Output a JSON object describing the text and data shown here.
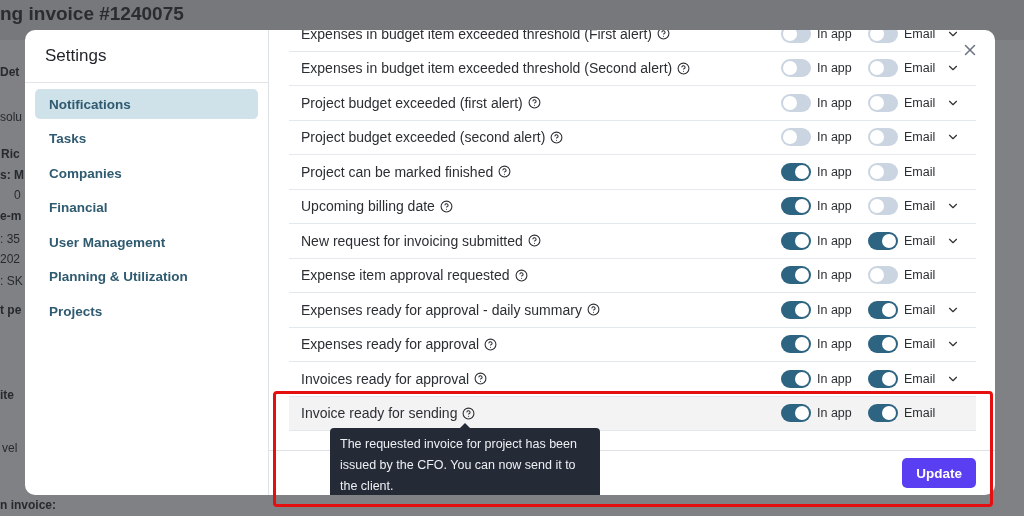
{
  "background": {
    "title": "ng invoice #1240075",
    "fragments": [
      {
        "text": "Det",
        "bold": true
      },
      {
        "text": "solu",
        "bold": false
      },
      {
        "text": "Ric",
        "bold": true
      },
      {
        "text": "s: M",
        "bold": true
      },
      {
        "text": "0",
        "bold": false
      },
      {
        "text": "e-m",
        "bold": true
      },
      {
        "text": ": 35",
        "bold": false
      },
      {
        "text": "202",
        "bold": false
      },
      {
        "text": ": SK",
        "bold": false
      },
      {
        "text": "t pe",
        "bold": true
      },
      {
        "text": "ite",
        "bold": true
      },
      {
        "text": "vel",
        "bold": false
      },
      {
        "text": "n invoice:",
        "bold": true
      }
    ]
  },
  "settings": {
    "title": "Settings",
    "sidebar": {
      "items": [
        {
          "label": "Notifications",
          "selected": true
        },
        {
          "label": "Tasks",
          "selected": false
        },
        {
          "label": "Companies",
          "selected": false
        },
        {
          "label": "Financial",
          "selected": false
        },
        {
          "label": "User Management",
          "selected": false
        },
        {
          "label": "Planning & Utilization",
          "selected": false
        },
        {
          "label": "Projects",
          "selected": false
        }
      ]
    },
    "notifications": [
      {
        "label": "Expenses in budget item exceeded threshold (First alert)",
        "in_app": false,
        "in_app_label": "In app",
        "email": false,
        "email_label": "Email",
        "expandable": true,
        "highlighted": false
      },
      {
        "label": "Expenses in budget item exceeded threshold (Second alert)",
        "in_app": false,
        "in_app_label": "In app",
        "email": false,
        "email_label": "Email",
        "expandable": true,
        "highlighted": false
      },
      {
        "label": "Project budget exceeded (first alert)",
        "in_app": false,
        "in_app_label": "In app",
        "email": false,
        "email_label": "Email",
        "expandable": true,
        "highlighted": false
      },
      {
        "label": "Project budget exceeded (second alert)",
        "in_app": false,
        "in_app_label": "In app",
        "email": false,
        "email_label": "Email",
        "expandable": true,
        "highlighted": false
      },
      {
        "label": "Project can be marked finished",
        "in_app": true,
        "in_app_label": "In app",
        "email": false,
        "email_label": "Email",
        "expandable": false,
        "highlighted": false
      },
      {
        "label": "Upcoming billing date",
        "in_app": true,
        "in_app_label": "In app",
        "email": false,
        "email_label": "Email",
        "expandable": true,
        "highlighted": false
      },
      {
        "label": "New request for invoicing submitted",
        "in_app": true,
        "in_app_label": "In app",
        "email": true,
        "email_label": "Email",
        "expandable": true,
        "highlighted": false
      },
      {
        "label": "Expense item approval requested",
        "in_app": true,
        "in_app_label": "In app",
        "email": false,
        "email_label": "Email",
        "expandable": false,
        "highlighted": false
      },
      {
        "label": "Expenses ready for approval - daily summary",
        "in_app": true,
        "in_app_label": "In app",
        "email": true,
        "email_label": "Email",
        "expandable": true,
        "highlighted": false
      },
      {
        "label": "Expenses ready for approval",
        "in_app": true,
        "in_app_label": "In app",
        "email": true,
        "email_label": "Email",
        "expandable": true,
        "highlighted": false
      },
      {
        "label": "Invoices ready for approval",
        "in_app": true,
        "in_app_label": "In app",
        "email": true,
        "email_label": "Email",
        "expandable": true,
        "highlighted": false
      },
      {
        "label": "Invoice ready for sending",
        "in_app": true,
        "in_app_label": "In app",
        "email": true,
        "email_label": "Email",
        "expandable": false,
        "highlighted": true
      }
    ],
    "tooltip": "The requested invoice for project has been issued by the CFO. You can now send it to the client.",
    "update_button": "Update"
  }
}
